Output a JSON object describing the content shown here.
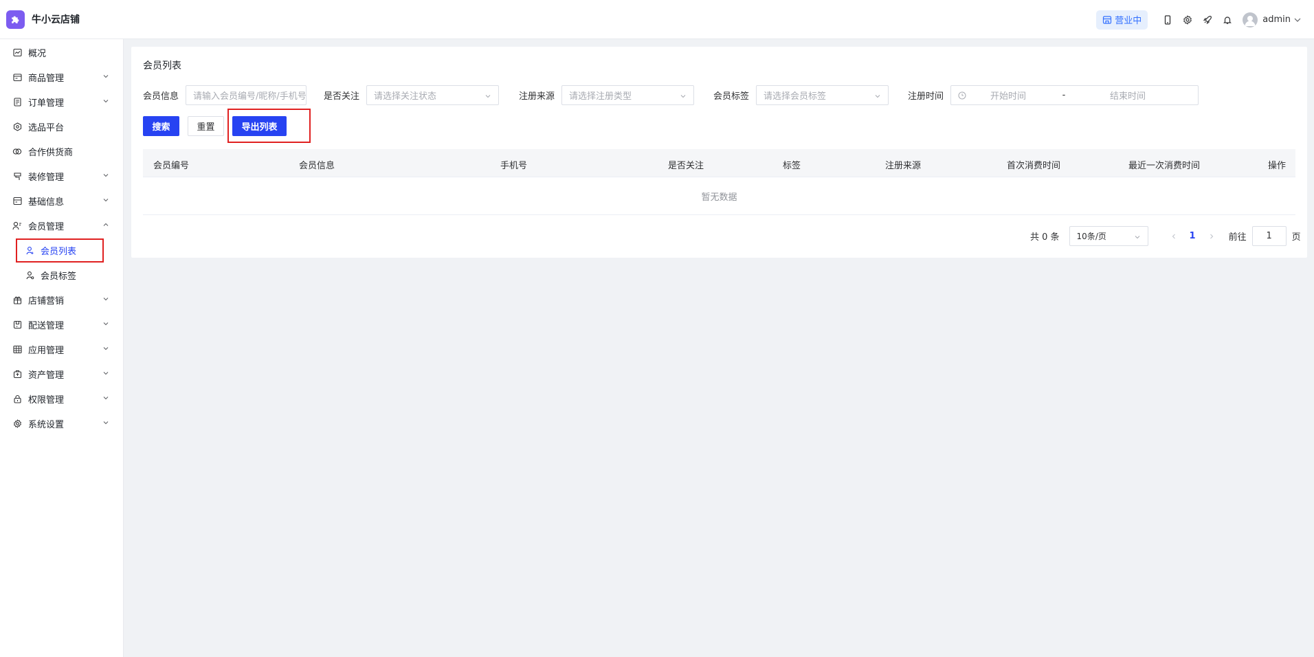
{
  "app": {
    "name": "牛小云店铺",
    "status_label": "营业中",
    "user_name": "admin",
    "brand_color": "#7c5cf0",
    "accent_color": "#2743f2"
  },
  "sidebar": {
    "items": [
      {
        "label": "概况",
        "icon": "chart-icon"
      },
      {
        "label": "商品管理",
        "icon": "goods-icon"
      },
      {
        "label": "订单管理",
        "icon": "order-icon"
      },
      {
        "label": "选品平台",
        "icon": "select-icon"
      },
      {
        "label": "合作供货商",
        "icon": "supplier-icon"
      },
      {
        "label": "装修管理",
        "icon": "decorate-icon"
      },
      {
        "label": "基础信息",
        "icon": "info-icon"
      },
      {
        "label": "会员管理",
        "icon": "member-icon"
      },
      {
        "label": "会员列表",
        "icon": "user-icon"
      },
      {
        "label": "会员标签",
        "icon": "tag-user-icon"
      },
      {
        "label": "店铺营销",
        "icon": "gift-icon"
      },
      {
        "label": "配送管理",
        "icon": "delivery-icon"
      },
      {
        "label": "应用管理",
        "icon": "apps-icon"
      },
      {
        "label": "资产管理",
        "icon": "asset-icon"
      },
      {
        "label": "权限管理",
        "icon": "lock-icon"
      },
      {
        "label": "系统设置",
        "icon": "settings-icon"
      }
    ]
  },
  "main": {
    "title": "会员列表",
    "filters": {
      "member_info_label": "会员信息",
      "member_info_placeholder": "请输入会员编号/昵称/手机号",
      "follow_label": "是否关注",
      "follow_placeholder": "请选择关注状态",
      "source_label": "注册来源",
      "source_placeholder": "请选择注册类型",
      "tag_label": "会员标签",
      "tag_placeholder": "请选择会员标签",
      "time_label": "注册时间",
      "start_placeholder": "开始时间",
      "range_sep": "-",
      "end_placeholder": "结束时间"
    },
    "buttons": {
      "search": "搜索",
      "reset": "重置",
      "export": "导出列表"
    },
    "table": {
      "columns": [
        "会员编号",
        "会员信息",
        "手机号",
        "是否关注",
        "标签",
        "注册来源",
        "首次消费时间",
        "最近一次消费时间",
        "操作"
      ],
      "empty_text": "暂无数据"
    },
    "pagination": {
      "total_text": "共 0 条",
      "page_size": "10条/页",
      "current_page": "1",
      "goto_label": "前往",
      "goto_value": "1",
      "page_suffix": "页"
    }
  }
}
